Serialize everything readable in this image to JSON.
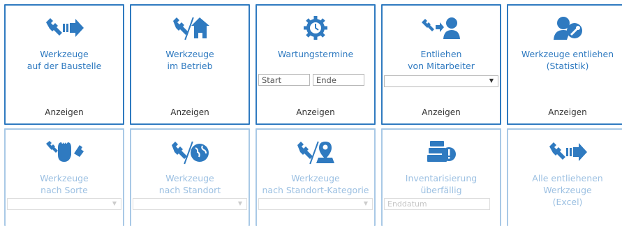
{
  "colors": {
    "accent": "#2f7ac0",
    "accent_disabled": "#9cc0e2"
  },
  "row1": [
    {
      "icon": "wrench-arrow-icon",
      "title_line1": "Werkzeuge",
      "title_line2": "auf der Baustelle",
      "action": "Anzeigen"
    },
    {
      "icon": "wrench-house-icon",
      "title_line1": "Werkzeuge",
      "title_line2": "im Betrieb",
      "action": "Anzeigen"
    },
    {
      "icon": "gear-clock-icon",
      "title_line1": "Wartungstermine",
      "title_line2": "",
      "action": "Anzeigen",
      "start_placeholder": "Start",
      "end_placeholder": "Ende"
    },
    {
      "icon": "wrench-person-icon",
      "title_line1": "Entliehen",
      "title_line2": "von Mitarbeiter",
      "action": "Anzeigen"
    },
    {
      "icon": "person-wrench-icon",
      "title_line1": "Werkzeuge entliehen",
      "title_line2": "(Statistik)",
      "action": "Anzeigen"
    }
  ],
  "row2": [
    {
      "icon": "tools-hand-icon",
      "title_line1": "Werkzeuge",
      "title_line2": "nach Sorte"
    },
    {
      "icon": "wrench-globe-icon",
      "title_line1": "Werkzeuge",
      "title_line2": "nach Standort"
    },
    {
      "icon": "wrench-location-icon",
      "title_line1": "Werkzeuge",
      "title_line2": "nach Standort-Kategorie"
    },
    {
      "icon": "inventory-warning-icon",
      "title_line1": "Inventarisierung",
      "title_line2": "überfällig",
      "field_placeholder": "Enddatum"
    },
    {
      "icon": "wrench-arrow-icon",
      "title_line1": "Alle entliehenen Werkzeuge",
      "title_line2": "(Excel)"
    }
  ]
}
